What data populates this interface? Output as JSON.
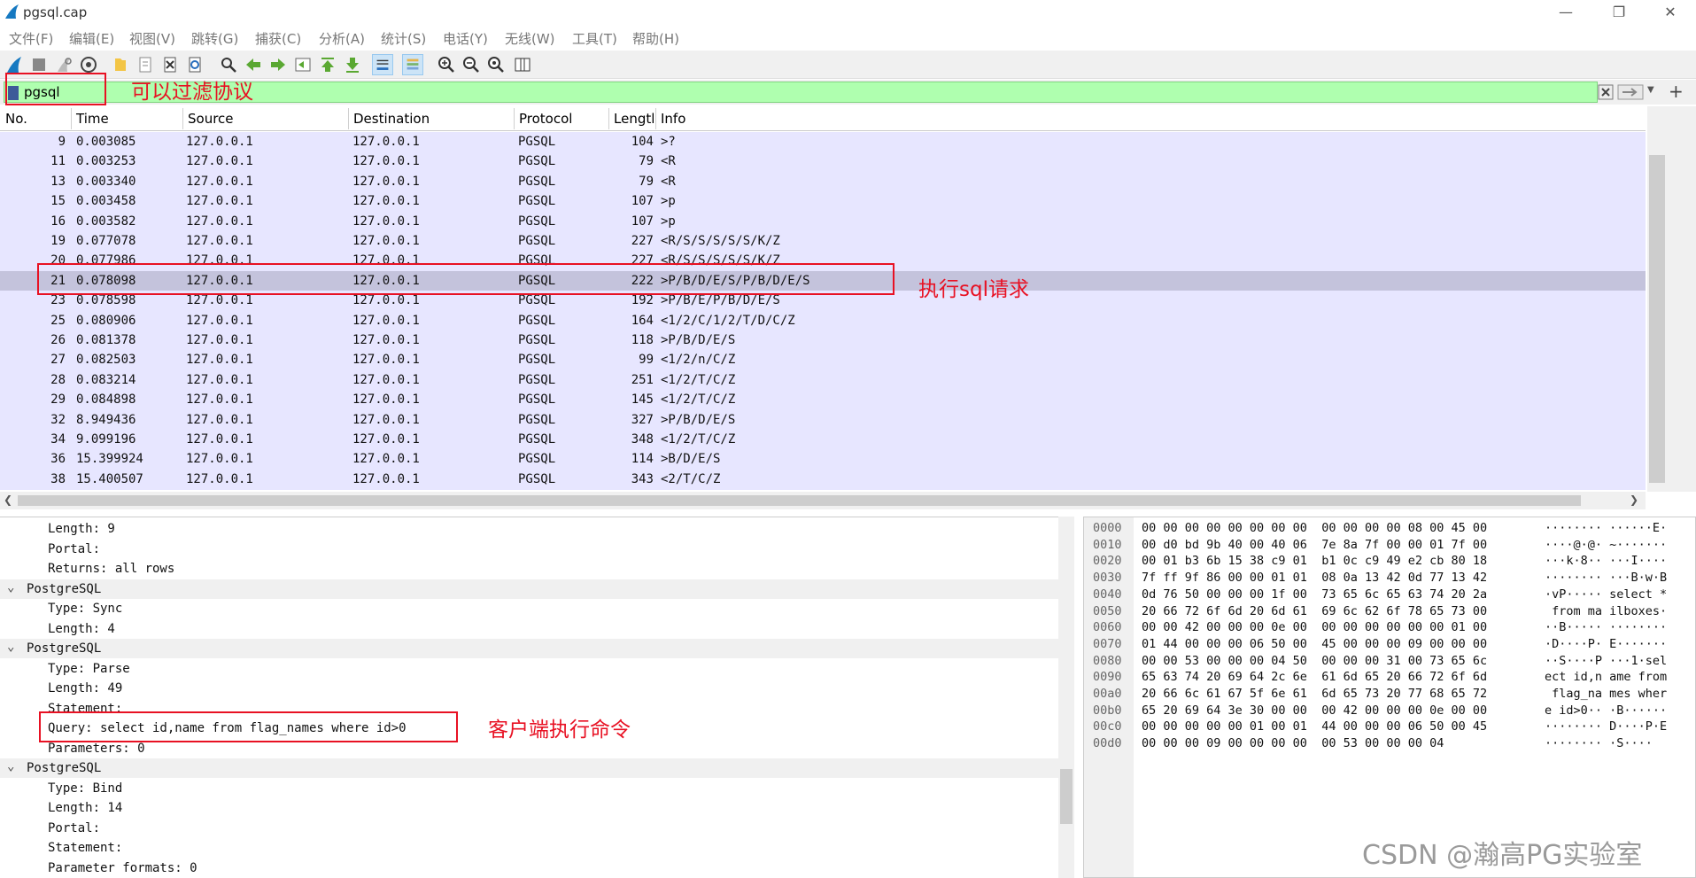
{
  "window": {
    "title": "pgsql.cap",
    "minimize": "—",
    "restore": "❐",
    "close": "✕"
  },
  "menu": [
    "文件(F)",
    "编辑(E)",
    "视图(V)",
    "跳转(G)",
    "捕获(C)",
    "分析(A)",
    "统计(S)",
    "电话(Y)",
    "无线(W)",
    "工具(T)",
    "帮助(H)"
  ],
  "filter": {
    "value": "pgsql"
  },
  "packet_list": {
    "columns": [
      "No.",
      "Time",
      "Source",
      "Destination",
      "Protocol",
      "Lengtl",
      "Info"
    ],
    "rows": [
      {
        "no": "9",
        "time": "0.003085",
        "src": "127.0.0.1",
        "dst": "127.0.0.1",
        "proto": "PGSQL",
        "len": "104",
        "info": ">?"
      },
      {
        "no": "11",
        "time": "0.003253",
        "src": "127.0.0.1",
        "dst": "127.0.0.1",
        "proto": "PGSQL",
        "len": "79",
        "info": "<R"
      },
      {
        "no": "13",
        "time": "0.003340",
        "src": "127.0.0.1",
        "dst": "127.0.0.1",
        "proto": "PGSQL",
        "len": "79",
        "info": "<R"
      },
      {
        "no": "15",
        "time": "0.003458",
        "src": "127.0.0.1",
        "dst": "127.0.0.1",
        "proto": "PGSQL",
        "len": "107",
        "info": ">p"
      },
      {
        "no": "16",
        "time": "0.003582",
        "src": "127.0.0.1",
        "dst": "127.0.0.1",
        "proto": "PGSQL",
        "len": "107",
        "info": ">p"
      },
      {
        "no": "19",
        "time": "0.077078",
        "src": "127.0.0.1",
        "dst": "127.0.0.1",
        "proto": "PGSQL",
        "len": "227",
        "info": "<R/S/S/S/S/S/K/Z"
      },
      {
        "no": "20",
        "time": "0.077986",
        "src": "127.0.0.1",
        "dst": "127.0.0.1",
        "proto": "PGSQL",
        "len": "227",
        "info": "<R/S/S/S/S/S/K/Z"
      },
      {
        "no": "21",
        "time": "0.078098",
        "src": "127.0.0.1",
        "dst": "127.0.0.1",
        "proto": "PGSQL",
        "len": "222",
        "info": ">P/B/D/E/S/P/B/D/E/S"
      },
      {
        "no": "23",
        "time": "0.078598",
        "src": "127.0.0.1",
        "dst": "127.0.0.1",
        "proto": "PGSQL",
        "len": "192",
        "info": ">P/B/E/P/B/D/E/S"
      },
      {
        "no": "25",
        "time": "0.080906",
        "src": "127.0.0.1",
        "dst": "127.0.0.1",
        "proto": "PGSQL",
        "len": "164",
        "info": "<1/2/C/1/2/T/D/C/Z"
      },
      {
        "no": "26",
        "time": "0.081378",
        "src": "127.0.0.1",
        "dst": "127.0.0.1",
        "proto": "PGSQL",
        "len": "118",
        "info": ">P/B/D/E/S"
      },
      {
        "no": "27",
        "time": "0.082503",
        "src": "127.0.0.1",
        "dst": "127.0.0.1",
        "proto": "PGSQL",
        "len": "99",
        "info": "<1/2/n/C/Z"
      },
      {
        "no": "28",
        "time": "0.083214",
        "src": "127.0.0.1",
        "dst": "127.0.0.1",
        "proto": "PGSQL",
        "len": "251",
        "info": "<1/2/T/C/Z"
      },
      {
        "no": "29",
        "time": "0.084898",
        "src": "127.0.0.1",
        "dst": "127.0.0.1",
        "proto": "PGSQL",
        "len": "145",
        "info": "<1/2/T/C/Z"
      },
      {
        "no": "32",
        "time": "8.949436",
        "src": "127.0.0.1",
        "dst": "127.0.0.1",
        "proto": "PGSQL",
        "len": "327",
        "info": ">P/B/D/E/S"
      },
      {
        "no": "34",
        "time": "9.099196",
        "src": "127.0.0.1",
        "dst": "127.0.0.1",
        "proto": "PGSQL",
        "len": "348",
        "info": "<1/2/T/C/Z"
      },
      {
        "no": "36",
        "time": "15.399924",
        "src": "127.0.0.1",
        "dst": "127.0.0.1",
        "proto": "PGSQL",
        "len": "114",
        "info": ">B/D/E/S"
      },
      {
        "no": "38",
        "time": "15.400507",
        "src": "127.0.0.1",
        "dst": "127.0.0.1",
        "proto": "PGSQL",
        "len": "343",
        "info": "<2/T/C/Z"
      }
    ]
  },
  "details": [
    {
      "text": "Length: 9",
      "indent": 1
    },
    {
      "text": "Portal:",
      "indent": 1
    },
    {
      "text": "Returns: all rows",
      "indent": 1
    },
    {
      "text": "PostgreSQL",
      "indent": 0,
      "header": true
    },
    {
      "text": "Type: Sync",
      "indent": 1
    },
    {
      "text": "Length: 4",
      "indent": 1
    },
    {
      "text": "PostgreSQL",
      "indent": 0,
      "header": true
    },
    {
      "text": "Type: Parse",
      "indent": 1
    },
    {
      "text": "Length: 49",
      "indent": 1
    },
    {
      "text": "Statement:",
      "indent": 1
    },
    {
      "text": "Query: select id,name from flag_names where id>0",
      "indent": 1
    },
    {
      "text": "Parameters: 0",
      "indent": 1
    },
    {
      "text": "PostgreSQL",
      "indent": 0,
      "header": true
    },
    {
      "text": "Type: Bind",
      "indent": 1
    },
    {
      "text": "Length: 14",
      "indent": 1
    },
    {
      "text": "Portal:",
      "indent": 1
    },
    {
      "text": "Statement:",
      "indent": 1
    },
    {
      "text": "Parameter formats: 0",
      "indent": 1
    }
  ],
  "bytes": [
    {
      "off": "0000",
      "hex": "00 00 00 00 00 00 00 00  00 00 00 00 08 00 45 00",
      "ascii": "········ ······E·"
    },
    {
      "off": "0010",
      "hex": "00 d0 bd 9b 40 00 40 06  7e 8a 7f 00 00 01 7f 00",
      "ascii": "····@·@· ~·······"
    },
    {
      "off": "0020",
      "hex": "00 01 b3 6b 15 38 c9 01  b1 0c c9 49 e2 cb 80 18",
      "ascii": "···k·8·· ···I····"
    },
    {
      "off": "0030",
      "hex": "7f ff 9f 86 00 00 01 01  08 0a 13 42 0d 77 13 42",
      "ascii": "········ ···B·w·B"
    },
    {
      "off": "0040",
      "hex": "0d 76 50 00 00 00 1f 00  73 65 6c 65 63 74 20 2a",
      "ascii": "·vP····· select *"
    },
    {
      "off": "0050",
      "hex": "20 66 72 6f 6d 20 6d 61  69 6c 62 6f 78 65 73 00",
      "ascii": " from ma ilboxes·"
    },
    {
      "off": "0060",
      "hex": "00 00 42 00 00 00 0e 00  00 00 00 00 00 00 01 00",
      "ascii": "··B····· ········"
    },
    {
      "off": "0070",
      "hex": "01 44 00 00 00 06 50 00  45 00 00 00 09 00 00 00",
      "ascii": "·D····P· E·······"
    },
    {
      "off": "0080",
      "hex": "00 00 53 00 00 00 04 50  00 00 00 31 00 73 65 6c",
      "ascii": "··S····P ···1·sel"
    },
    {
      "off": "0090",
      "hex": "65 63 74 20 69 64 2c 6e  61 6d 65 20 66 72 6f 6d",
      "ascii": "ect id,n ame from"
    },
    {
      "off": "00a0",
      "hex": "20 66 6c 61 67 5f 6e 61  6d 65 73 20 77 68 65 72",
      "ascii": " flag_na mes wher"
    },
    {
      "off": "00b0",
      "hex": "65 20 69 64 3e 30 00 00  00 42 00 00 00 0e 00 00",
      "ascii": "e id>0·· ·B······"
    },
    {
      "off": "00c0",
      "hex": "00 00 00 00 00 01 00 01  44 00 00 00 06 50 00 45",
      "ascii": "········ D····P·E"
    },
    {
      "off": "00d0",
      "hex": "00 00 00 09 00 00 00 00  00 53 00 00 00 04",
      "ascii": "········ ·S····"
    }
  ],
  "annotations": {
    "filter_note": "可以过滤协议",
    "sql_request_note": "执行sql请求",
    "client_cmd_note": "客户端执行命令"
  },
  "watermark": "CSDN @瀚高PG实验室",
  "colors": {
    "filter_bg": "#afffaf",
    "row_bg": "#e7e6ff",
    "row_selected": "#c4c3dc",
    "annotation": "#e81123"
  }
}
